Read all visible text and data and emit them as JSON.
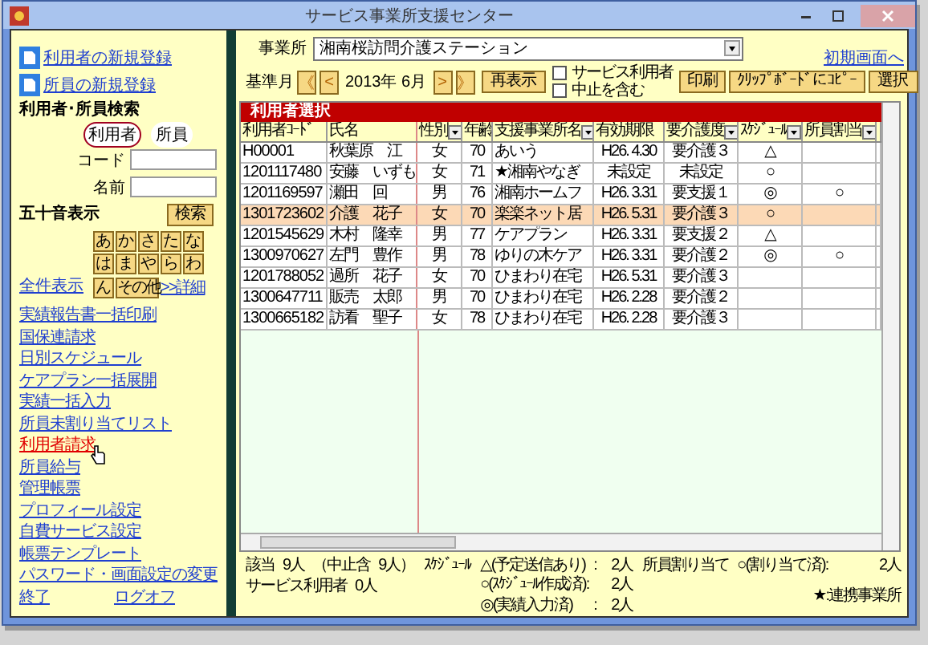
{
  "window": {
    "title": "サービス事業所支援センター"
  },
  "sidebar": {
    "register_links": [
      "利用者の新規登録",
      "所員の新規登録"
    ],
    "search_title": "利用者･所員検索",
    "modes": [
      {
        "label": "利用者",
        "selected": true
      },
      {
        "label": "所員",
        "selected": false
      }
    ],
    "code_label": "コード",
    "name_label": "名前",
    "kana_title": "五十音表示",
    "search_button": "検索",
    "kana": [
      "あ",
      "か",
      "さ",
      "た",
      "な",
      "は",
      "ま",
      "や",
      "ら",
      "わ",
      "ん"
    ],
    "other_button": "その他",
    "detail_link": ">>詳細",
    "all_link": "全件表示",
    "menu": [
      {
        "label": "実績報告書一括印刷",
        "selected": false
      },
      {
        "label": "国保連請求",
        "selected": false
      },
      {
        "label": "日別スケジュール",
        "selected": false
      },
      {
        "label": "ケアプラン一括展開",
        "selected": false
      },
      {
        "label": "実績一括入力",
        "selected": false
      },
      {
        "label": "所員未割り当てリスト",
        "selected": false
      },
      {
        "label": "利用者請求",
        "selected": true
      },
      {
        "label": "所員給与",
        "selected": false
      },
      {
        "label": "管理帳票",
        "selected": false
      },
      {
        "label": "プロフィール設定",
        "selected": false
      },
      {
        "label": "自費サービス設定",
        "selected": false
      },
      {
        "label": "帳票テンプレート",
        "selected": false
      },
      {
        "label": "パスワード・画面設定の変更",
        "selected": false
      }
    ],
    "footer_links": [
      "終了",
      "ログオフ"
    ]
  },
  "toolbar": {
    "office_label": "事業所",
    "office_value": "湘南桜訪問介護ステーション",
    "home_link": "初期画面へ",
    "month_label": "基準月",
    "nav": [
      "《",
      "<",
      ">",
      "》"
    ],
    "month": "2013年 6月",
    "redisplay": "再表示",
    "checkboxes": [
      {
        "label": "サービス利用者",
        "checked": false
      },
      {
        "label": "中止を含む",
        "checked": false
      }
    ],
    "print": "印刷",
    "copy": "ｸﾘｯﾌﾟﾎﾞｰﾄﾞにｺﾋﾟｰ",
    "select": "選択"
  },
  "table": {
    "title": "利用者選択",
    "columns": [
      {
        "label": "利用者ｺｰﾄﾞ",
        "dropdown": false
      },
      {
        "label": "氏名",
        "dropdown": false
      },
      {
        "label": "性別",
        "dropdown": true
      },
      {
        "label": "年齢",
        "dropdown": false
      },
      {
        "label": "支援事業所名",
        "dropdown": true
      },
      {
        "label": "有効期限",
        "dropdown": false
      },
      {
        "label": "要介護度",
        "dropdown": true
      },
      {
        "label": "ｽｹｼﾞｭｰﾙ",
        "dropdown": true
      },
      {
        "label": "所員割当",
        "dropdown": true
      }
    ],
    "rows": [
      {
        "selected": false,
        "cells": [
          "H00001",
          "秋葉原　江",
          "女",
          "70",
          "あいう",
          "H26. 4.30",
          "要介護３",
          "△",
          ""
        ]
      },
      {
        "selected": false,
        "cells": [
          "1201117480",
          "安藤　いずも",
          "女",
          "71",
          "★湘南やなぎ",
          "未設定",
          "未設定",
          "○",
          ""
        ]
      },
      {
        "selected": false,
        "cells": [
          "1201169597",
          "瀬田　回",
          "男",
          "76",
          "湘南ホームフ",
          "H26. 3.31",
          "要支援１",
          "◎",
          "○"
        ]
      },
      {
        "selected": true,
        "cells": [
          "1301723602",
          "介護　花子",
          "女",
          "70",
          "楽楽ネット居",
          "H26. 5.31",
          "要介護３",
          "○",
          ""
        ]
      },
      {
        "selected": false,
        "cells": [
          "1201545629",
          "木村　隆幸",
          "男",
          "77",
          "ケアプラン",
          "H26. 3.31",
          "要支援２",
          "△",
          ""
        ]
      },
      {
        "selected": false,
        "cells": [
          "1300970627",
          "左門　豊作",
          "男",
          "78",
          "ゆりの木ケア",
          "H26. 3.31",
          "要介護２",
          "◎",
          "○"
        ]
      },
      {
        "selected": false,
        "cells": [
          "1201788052",
          "過所　花子",
          "女",
          "70",
          "ひまわり在宅",
          "H26. 5.31",
          "要介護３",
          "",
          ""
        ]
      },
      {
        "selected": false,
        "cells": [
          "1300647711",
          "販売　太郎",
          "男",
          "70",
          "ひまわり在宅",
          "H26. 2.28",
          "要介護２",
          "",
          ""
        ]
      },
      {
        "selected": false,
        "cells": [
          "1300665182",
          "訪看　聖子",
          "女",
          "78",
          "ひまわり在宅",
          "H26. 2.28",
          "要介護３",
          "",
          ""
        ]
      }
    ]
  },
  "summary": {
    "count_label": "該当",
    "count": "9人",
    "stopped": "（中止含",
    "stopped_count": "9人）",
    "service_label": "サービス利用者",
    "service_count": "0人",
    "schedule_label": "ｽｹｼﾞｭｰﾙ",
    "schedule": [
      {
        "label": "△(予定送信あり)",
        "colon": ":",
        "count": "2人"
      },
      {
        "label": "○(ｽｹｼﾞｭｰﾙ作成済):",
        "count": "2人"
      },
      {
        "label": "◎(実績入力済)",
        "colon": ":",
        "count": "2人"
      }
    ],
    "staff_label": "所員割り当て",
    "staff_item": "○(割り当て済):",
    "staff_count": "2人",
    "legend": "★:連携事業所"
  }
}
